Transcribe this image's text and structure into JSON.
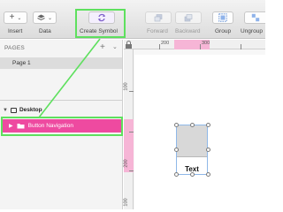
{
  "toolbar": {
    "insert_label": "Insert",
    "data_label": "Data",
    "create_symbol_label": "Create Symbol",
    "forward_label": "Forward",
    "backward_label": "Backward",
    "group_label": "Group",
    "ungroup_label": "Ungroup"
  },
  "sidebar": {
    "pages_heading": "PAGES",
    "pages": [
      {
        "label": "Page 1"
      }
    ],
    "artboard_label": "Desktop",
    "layers": [
      {
        "label": "Button Navigation"
      }
    ]
  },
  "rulers": {
    "h_ticks": [
      "200",
      "300"
    ],
    "v_ticks": [
      "100",
      "200",
      "100"
    ]
  },
  "canvas": {
    "symbol_text": "Text"
  },
  "colors": {
    "accent_pink": "#ee4aa0",
    "highlight_green": "#5ee05e",
    "symbol_purple": "#7b5cc9"
  }
}
